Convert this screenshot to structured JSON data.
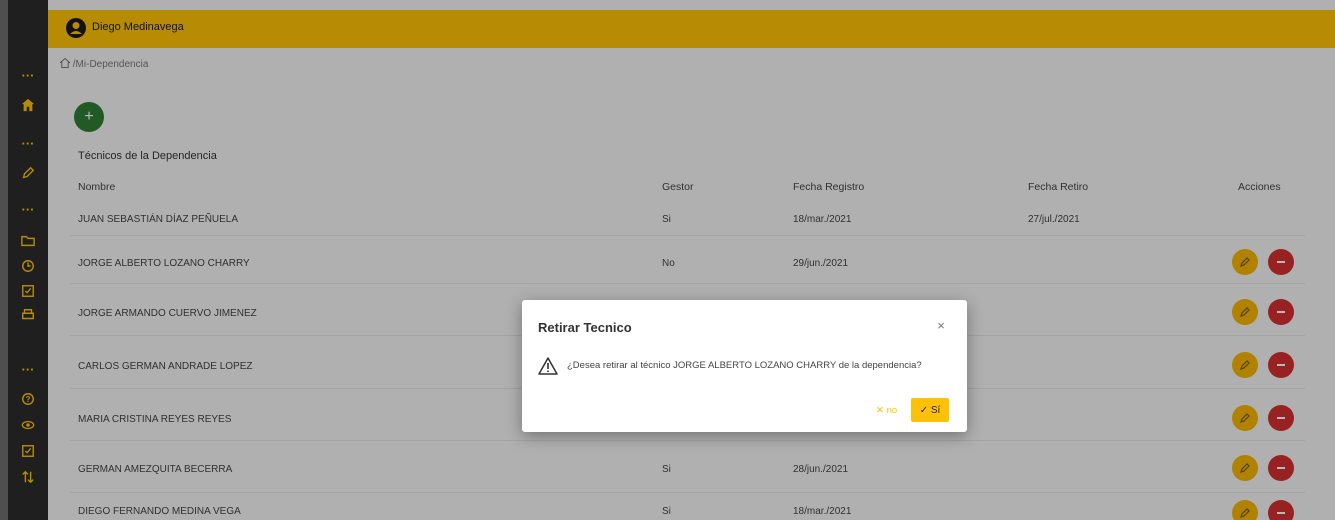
{
  "header": {
    "user_name": "Diego Medinavega"
  },
  "breadcrumb": {
    "label": "/Mi-Dependencia"
  },
  "add_button": {
    "label": "+"
  },
  "section": {
    "title": "Técnicos de la Dependencia"
  },
  "table": {
    "columns": [
      "Nombre",
      "Gestor",
      "Fecha Registro",
      "Fecha Retiro",
      "Acciones"
    ],
    "rows": [
      {
        "nombre": "JUAN SEBASTIÁN DÍAZ PEÑUELA",
        "gestor": "Si",
        "registro": "18/mar./2021",
        "retiro": "27/jul./2021"
      },
      {
        "nombre": "JORGE ALBERTO LOZANO CHARRY",
        "gestor": "No",
        "registro": "29/jun./2021",
        "retiro": ""
      },
      {
        "nombre": "JORGE ARMANDO CUERVO JIMENEZ",
        "gestor": "",
        "registro": "",
        "retiro": ""
      },
      {
        "nombre": "CARLOS GERMAN ANDRADE LOPEZ",
        "gestor": "",
        "registro": "",
        "retiro": ""
      },
      {
        "nombre": "MARIA CRISTINA REYES REYES",
        "gestor": "",
        "registro": "",
        "retiro": ""
      },
      {
        "nombre": "GERMAN AMEZQUITA BECERRA",
        "gestor": "Si",
        "registro": "28/jun./2021",
        "retiro": ""
      },
      {
        "nombre": "DIEGO FERNANDO MEDINA VEGA",
        "gestor": "Si",
        "registro": "18/mar./2021",
        "retiro": ""
      }
    ]
  },
  "modal": {
    "title": "Retirar Tecnico",
    "close": "×",
    "message": "¿Desea retirar al técnico JORGE ALBERTO LOZANO CHARRY de la dependencia?",
    "no_label": "✕ no",
    "yes_label": "✓ Sí"
  },
  "sidebar": {
    "dots": "···"
  },
  "colors": {
    "accent": "#ffc107",
    "sidebar": "#2b2b2b",
    "add": "#2e7d32",
    "delete": "#d32f2f"
  }
}
